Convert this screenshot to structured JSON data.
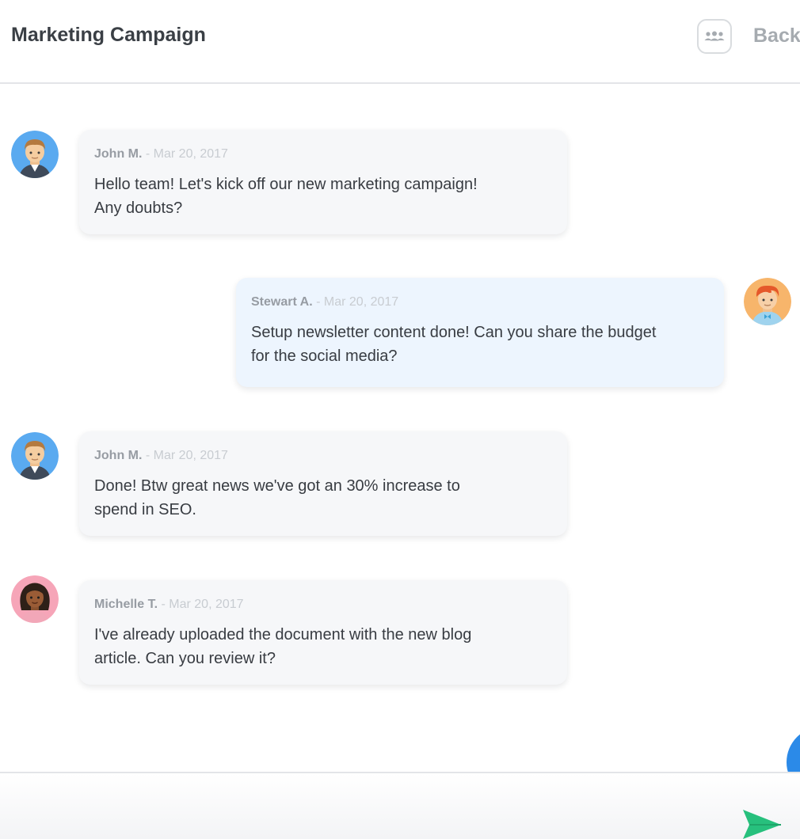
{
  "header": {
    "title": "Marketing Campaign",
    "members_icon": "group-icon",
    "back_label": "Back"
  },
  "messages": [
    {
      "author": "John M.",
      "separator": "-",
      "date": "Mar 20, 2017",
      "text": "Hello team! Let's kick off our new marketing campaign!\nAny doubts?",
      "direction": "incoming",
      "avatar": "john-avatar"
    },
    {
      "author": "Stewart A.",
      "separator": "-",
      "date": "Mar 20, 2017",
      "text": "Setup newsletter content done! Can you share the budget\nfor the social media?",
      "direction": "outgoing",
      "avatar": "stewart-avatar"
    },
    {
      "author": "John M.",
      "separator": "-",
      "date": "Mar 20, 2017",
      "text": "Done! Btw great news we've got an 30% increase to\nspend in SEO.",
      "direction": "incoming",
      "avatar": "john-avatar"
    },
    {
      "author": "Michelle T.",
      "separator": "-",
      "date": "Mar 20, 2017",
      "text": "I've already uploaded the document with the new blog\narticle. Can you review it?",
      "direction": "incoming",
      "avatar": "michelle-avatar"
    }
  ],
  "composer": {
    "placeholder": "",
    "send_icon": "send-icon"
  },
  "colors": {
    "incoming_bubble": "#f6f7f9",
    "outgoing_bubble": "#edf5fe",
    "send_accent": "#27c07d",
    "fab": "#2b8ae8"
  }
}
